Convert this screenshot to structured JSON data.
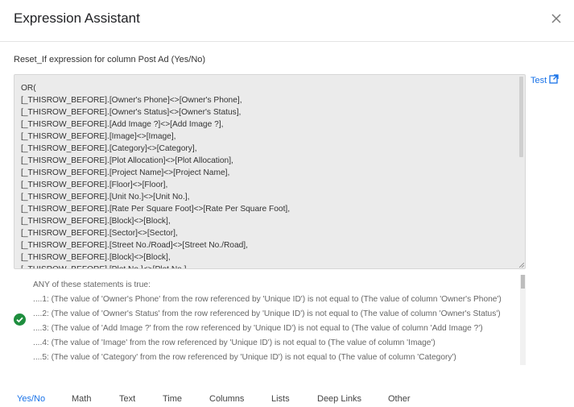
{
  "dialog": {
    "title": "Expression Assistant",
    "close_icon": "close-icon"
  },
  "subtitle": "Reset_If expression for column Post Ad (Yes/No)",
  "test_link": {
    "label": "Test",
    "icon": "open-in-new-icon",
    "color": "#1a73e8"
  },
  "expression_lines": [
    "OR(",
    "[_THISROW_BEFORE].[Owner's Phone]<>[Owner's Phone],",
    "[_THISROW_BEFORE].[Owner's Status]<>[Owner's Status],",
    "[_THISROW_BEFORE].[Add Image ?]<>[Add Image ?],",
    "[_THISROW_BEFORE].[Image]<>[Image],",
    "[_THISROW_BEFORE].[Category]<>[Category],",
    "[_THISROW_BEFORE].[Plot Allocation]<>[Plot Allocation],",
    "[_THISROW_BEFORE].[Project Name]<>[Project Name],",
    "[_THISROW_BEFORE].[Floor]<>[Floor],",
    "[_THISROW_BEFORE].[Unit No.]<>[Unit No.],",
    "[_THISROW_BEFORE].[Rate Per Square Foot]<>[Rate Per Square Foot],",
    "[_THISROW_BEFORE].[Block]<>[Block],",
    "[_THISROW_BEFORE].[Sector]<>[Sector],",
    "[_THISROW_BEFORE].[Street No./Road]<>[Street No./Road],",
    "[_THISROW_BEFORE].[Block]<>[Block],",
    "[_THISROW_BEFORE].[Plot No.]<>[Plot No.],"
  ],
  "status": {
    "icon": "check-circle-icon",
    "color": "#1e8e3e"
  },
  "explanation_lines": [
    "ANY of these statements is true:",
    "....1: (The value of 'Owner's Phone' from the row referenced by 'Unique ID') is not equal to (The value of column 'Owner's Phone')",
    "....2: (The value of 'Owner's Status' from the row referenced by 'Unique ID') is not equal to (The value of column 'Owner's Status')",
    "....3: (The value of 'Add Image ?' from the row referenced by 'Unique ID') is not equal to (The value of column 'Add Image ?')",
    "....4: (The value of 'Image' from the row referenced by 'Unique ID') is not equal to (The value of column 'Image')",
    "....5: (The value of 'Category' from the row referenced by 'Unique ID') is not equal to (The value of column 'Category')"
  ],
  "tabs": [
    {
      "label": "Yes/No",
      "active": true
    },
    {
      "label": "Math",
      "active": false
    },
    {
      "label": "Text",
      "active": false
    },
    {
      "label": "Time",
      "active": false
    },
    {
      "label": "Columns",
      "active": false
    },
    {
      "label": "Lists",
      "active": false
    },
    {
      "label": "Deep Links",
      "active": false
    },
    {
      "label": "Other",
      "active": false
    }
  ]
}
